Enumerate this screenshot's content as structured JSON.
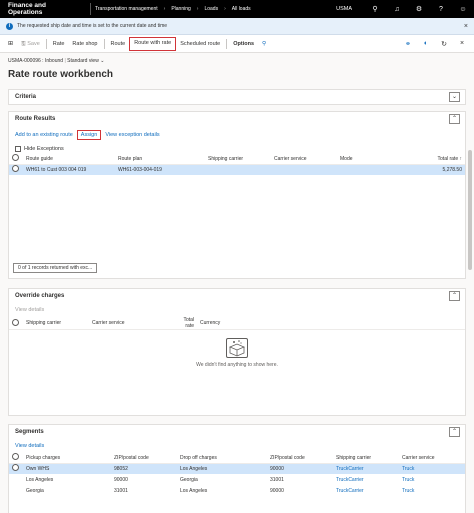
{
  "topbar": {
    "app_name": "Finance and Operations",
    "breadcrumbs": [
      "Transportation management",
      "Planning",
      "Loads",
      "All loads"
    ],
    "company": "USMA"
  },
  "infobar": {
    "message": "The requested ship date and time is set to the current date and time"
  },
  "actionbar": {
    "save": "Save",
    "rate": "Rate",
    "rate_shop": "Rate shop",
    "route": "Route",
    "route_with_rate": "Route with rate",
    "scheduled_route": "Scheduled route",
    "options": "Options"
  },
  "page": {
    "breadcrumb": "USMA-000096 : Inbound",
    "view": "Standard view",
    "title": "Rate route workbench"
  },
  "criteria": {
    "title": "Criteria"
  },
  "route_results": {
    "title": "Route Results",
    "add_link": "Add to an existing route",
    "assign_link": "Assign",
    "view_exceptions": "View exception details",
    "hide_exceptions": "Hide Exceptions",
    "columns": [
      "Route guide",
      "Route plan",
      "Shipping carrier",
      "Carrier service",
      "Mode",
      "Total rate"
    ],
    "rows": [
      {
        "route_guide": "WH61 to Cust 003 004 019",
        "route_plan": "WH61-003-004-019",
        "carrier": "",
        "service": "",
        "mode": "",
        "total": "5,278.50"
      }
    ],
    "records": "0 of 1 records returned with exc..."
  },
  "override": {
    "title": "Override charges",
    "view_details": "View details",
    "columns": [
      "Shipping carrier",
      "Carrier service",
      "Total rate",
      "Currency"
    ],
    "empty_message": "We didn't find anything to show here."
  },
  "segments": {
    "title": "Segments",
    "view_details": "View details",
    "columns": [
      "Pickup charges",
      "ZIP/postal code",
      "Drop off charges",
      "ZIP/postal code",
      "Shipping carrier",
      "Carrier service"
    ],
    "rows": [
      {
        "pickup": "Own WHS",
        "zip1": "98052",
        "dropoff": "Los Angeles",
        "zip2": "90000",
        "carrier": "TruckCarrier",
        "service": "Truck"
      },
      {
        "pickup": "Los Angeles",
        "zip1": "90000",
        "dropoff": "Georgia",
        "zip2": "31001",
        "carrier": "TruckCarrier",
        "service": "Truck"
      },
      {
        "pickup": "Georgia",
        "zip1": "31001",
        "dropoff": "Los Angeles",
        "zip2": "90000",
        "carrier": "TruckCarrier",
        "service": "Truck"
      }
    ]
  },
  "colors": {
    "accent": "#0f6cbd",
    "highlight": "#d13438",
    "selected_row": "#cfe4fa"
  }
}
